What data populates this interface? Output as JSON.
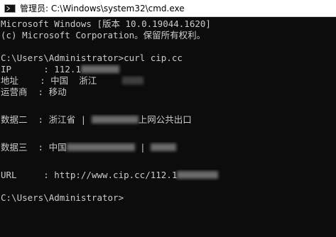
{
  "window": {
    "title": "管理员: C:\\Windows\\system32\\cmd.exe"
  },
  "console": {
    "banner_line1": "Microsoft Windows [版本 10.0.19044.1620]",
    "banner_line2": "(c) Microsoft Corporation。保留所有权利。",
    "command_line": "C:\\Users\\Administrator>curl cip.cc",
    "ip_label": "IP      : ",
    "ip_value": "112.1",
    "region_label": "地址    : ",
    "region_value": "中国  浙江",
    "isp_label": "运营商  : ",
    "isp_value": "移动",
    "data2_label": "数据二  : ",
    "data2_prefix": "浙江省 | ",
    "data2_suffix": "上网公共出口",
    "data3_label": "数据三  : ",
    "data3_prefix": "中国",
    "data3_suffix": " | ",
    "url_label": "URL     : ",
    "url_value": "http://www.cip.cc/112.1",
    "prompt_line": "C:\\Users\\Administrator>"
  },
  "colors": {
    "console_background": "#0c0c0c",
    "console_text": "#cccccc",
    "titlebar_background": "#ffffff"
  },
  "icons": {
    "window_icon": "cmd-icon"
  }
}
